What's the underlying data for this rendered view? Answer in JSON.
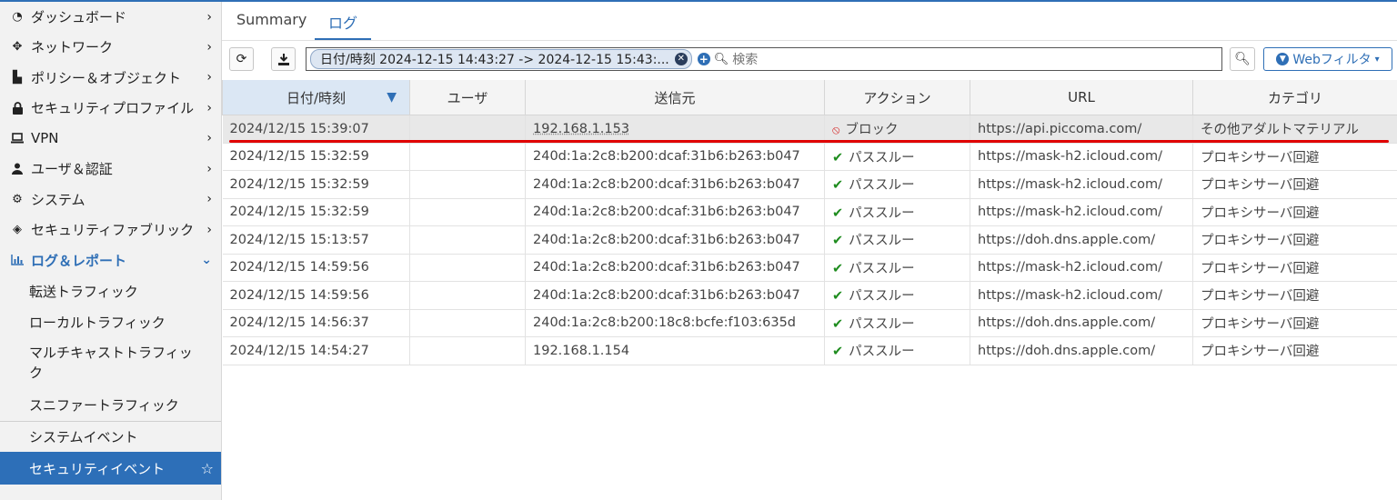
{
  "sidebar": {
    "items": [
      {
        "label": "ダッシュボード",
        "icon": "dashboard-icon"
      },
      {
        "label": "ネットワーク",
        "icon": "network-icon"
      },
      {
        "label": "ポリシー＆オブジェクト",
        "icon": "policy-icon"
      },
      {
        "label": "セキュリティプロファイル",
        "icon": "lock-icon"
      },
      {
        "label": "VPN",
        "icon": "laptop-icon"
      },
      {
        "label": "ユーザ＆認証",
        "icon": "user-icon"
      },
      {
        "label": "システム",
        "icon": "gear-icon"
      },
      {
        "label": "セキュリティファブリック",
        "icon": "fabric-icon"
      },
      {
        "label": "ログ＆レポート",
        "icon": "chart-icon"
      }
    ],
    "subitems": [
      {
        "label": "転送トラフィック"
      },
      {
        "label": "ローカルトラフィック"
      },
      {
        "label": "マルチキャストトラフィック"
      },
      {
        "label": "スニファートラフィック"
      },
      {
        "label": "システムイベント"
      },
      {
        "label": "セキュリティイベント"
      }
    ]
  },
  "tabs": [
    "Summary",
    "ログ"
  ],
  "toolbar": {
    "filter_chip": "日付/時刻 2024-12-15 14:43:27 -> 2024-12-15 15:43:...",
    "search_placeholder": "検索",
    "filter_button": "Webフィルタ"
  },
  "table": {
    "columns": [
      "日付/時刻",
      "ユーザ",
      "送信元",
      "アクション",
      "URL",
      "カテゴリ"
    ],
    "rows": [
      {
        "datetime": "2024/12/15 15:39:07",
        "user": "",
        "source": "192.168.1.153",
        "action": "ブロック",
        "action_type": "block",
        "url": "https://api.piccoma.com/",
        "category": "その他アダルトマテリアル"
      },
      {
        "datetime": "2024/12/15 15:32:59",
        "user": "",
        "source": "240d:1a:2c8:b200:dcaf:31b6:b263:b047",
        "action": "パススルー",
        "action_type": "pass",
        "url": "https://mask-h2.icloud.com/",
        "category": "プロキシサーバ回避"
      },
      {
        "datetime": "2024/12/15 15:32:59",
        "user": "",
        "source": "240d:1a:2c8:b200:dcaf:31b6:b263:b047",
        "action": "パススルー",
        "action_type": "pass",
        "url": "https://mask-h2.icloud.com/",
        "category": "プロキシサーバ回避"
      },
      {
        "datetime": "2024/12/15 15:32:59",
        "user": "",
        "source": "240d:1a:2c8:b200:dcaf:31b6:b263:b047",
        "action": "パススルー",
        "action_type": "pass",
        "url": "https://mask-h2.icloud.com/",
        "category": "プロキシサーバ回避"
      },
      {
        "datetime": "2024/12/15 15:13:57",
        "user": "",
        "source": "240d:1a:2c8:b200:dcaf:31b6:b263:b047",
        "action": "パススルー",
        "action_type": "pass",
        "url": "https://doh.dns.apple.com/",
        "category": "プロキシサーバ回避"
      },
      {
        "datetime": "2024/12/15 14:59:56",
        "user": "",
        "source": "240d:1a:2c8:b200:dcaf:31b6:b263:b047",
        "action": "パススルー",
        "action_type": "pass",
        "url": "https://mask-h2.icloud.com/",
        "category": "プロキシサーバ回避"
      },
      {
        "datetime": "2024/12/15 14:59:56",
        "user": "",
        "source": "240d:1a:2c8:b200:dcaf:31b6:b263:b047",
        "action": "パススルー",
        "action_type": "pass",
        "url": "https://mask-h2.icloud.com/",
        "category": "プロキシサーバ回避"
      },
      {
        "datetime": "2024/12/15 14:56:37",
        "user": "",
        "source": "240d:1a:2c8:b200:18c8:bcfe:f103:635d",
        "action": "パススルー",
        "action_type": "pass",
        "url": "https://doh.dns.apple.com/",
        "category": "プロキシサーバ回避"
      },
      {
        "datetime": "2024/12/15 14:54:27",
        "user": "",
        "source": "192.168.1.154",
        "action": "パススルー",
        "action_type": "pass",
        "url": "https://doh.dns.apple.com/",
        "category": "プロキシサーバ回避"
      }
    ]
  },
  "colors": {
    "accent": "#2f6fb6",
    "block": "#d42020",
    "pass": "#1e8c1e",
    "highlight_line": "#e00000"
  }
}
